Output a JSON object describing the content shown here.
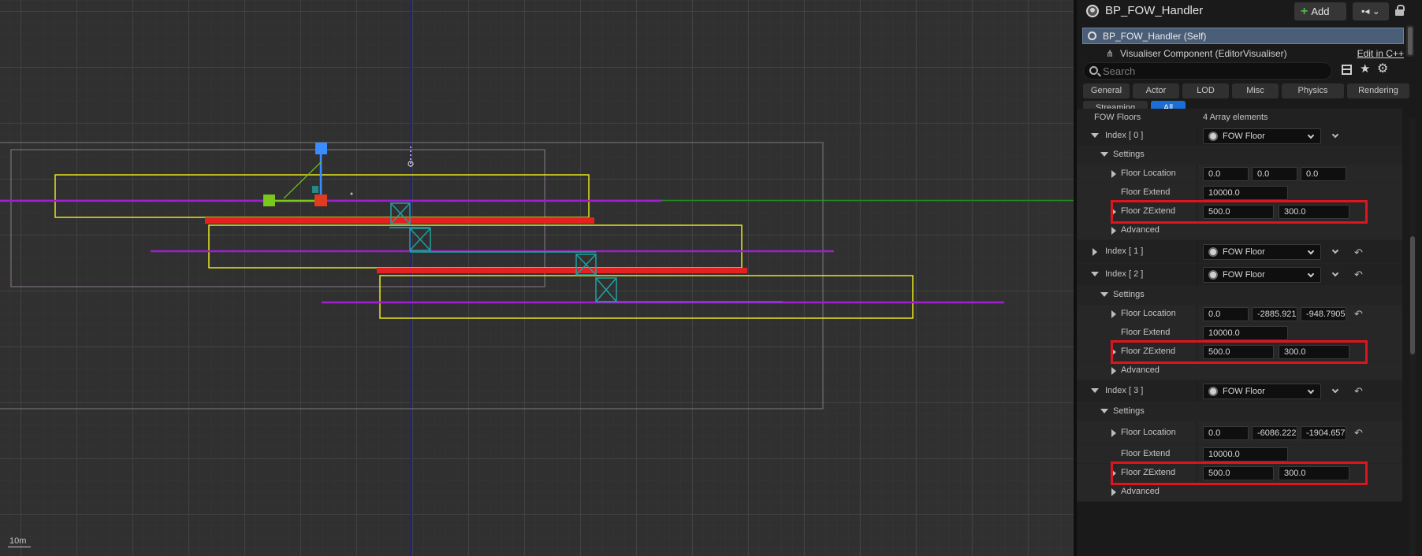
{
  "viewport": {
    "scale_label": "10m"
  },
  "details": {
    "title": "BP_FOW_Handler",
    "add_label": "Add",
    "blueprint_options_label": "▪◂",
    "self_label": "BP_FOW_Handler (Self)",
    "component_label": "Visualiser Component (EditorVisualiser)",
    "edit_cpp_label": "Edit in C++",
    "search_placeholder": "Search",
    "filters": [
      "General",
      "Actor",
      "LOD",
      "Misc",
      "Physics",
      "Rendering",
      "Streaming",
      "All"
    ],
    "active_filter": "All",
    "partial_header": "FOW Floors",
    "partial_value": "4 Array elements"
  },
  "floors": [
    {
      "index_label": "Index [ 0 ]",
      "type": "FOW Floor",
      "settings_label": "Settings",
      "location_label": "Floor Location",
      "location": [
        "0.0",
        "0.0",
        "0.0"
      ],
      "extend_label": "Floor Extend",
      "extend": "10000.0",
      "zextend_label": "Floor ZExtend",
      "zextend": [
        "500.0",
        "300.0"
      ],
      "advanced_label": "Advanced"
    },
    {
      "index_label": "Index [ 1 ]",
      "type": "FOW Floor"
    },
    {
      "index_label": "Index [ 2 ]",
      "type": "FOW Floor",
      "settings_label": "Settings",
      "location_label": "Floor Location",
      "location": [
        "0.0",
        "-2885.921",
        "-948.7905"
      ],
      "extend_label": "Floor Extend",
      "extend": "10000.0",
      "zextend_label": "Floor ZExtend",
      "zextend": [
        "500.0",
        "300.0"
      ],
      "advanced_label": "Advanced"
    },
    {
      "index_label": "Index [ 3 ]",
      "type": "FOW Floor",
      "settings_label": "Settings",
      "location_label": "Floor Location",
      "location": [
        "0.0",
        "-6086.222",
        "-1904.657"
      ],
      "extend_label": "Floor Extend",
      "extend": "10000.0",
      "zextend_label": "Floor ZExtend",
      "zextend": [
        "500.0",
        "300.0"
      ],
      "advanced_label": "Advanced"
    }
  ],
  "colors": {
    "highlight": "#e0141e",
    "floor_outline": "#e6e61e",
    "floor_plane": "#a020d0",
    "gizmo_z": "#3a8cff",
    "gizmo_x": "#e03a20",
    "gizmo_y": "#7ac81e",
    "world_x_axis": "#1f8f1f",
    "world_z_axis": "#1a1aa0",
    "active_filter": "#1a6fd6"
  }
}
